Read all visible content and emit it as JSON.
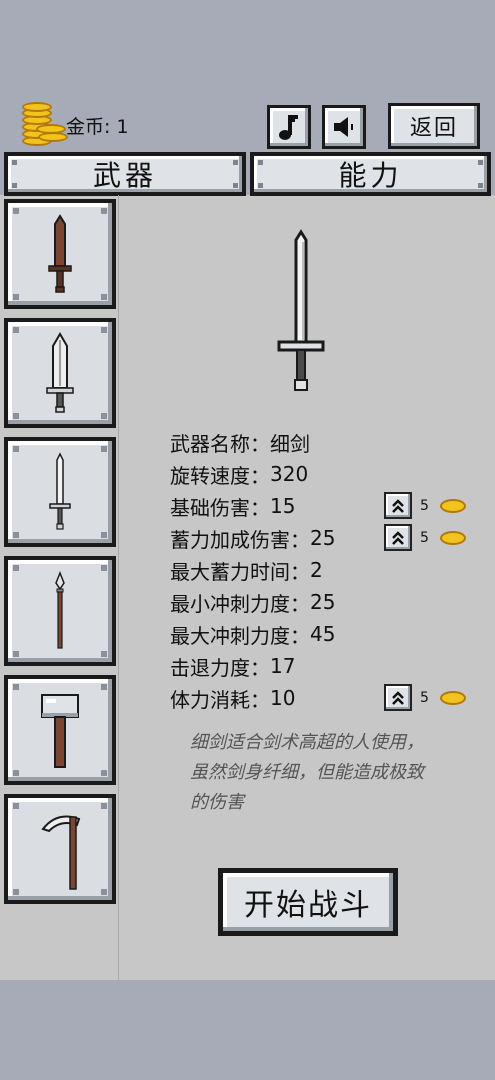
{
  "header": {
    "coins_label": "金币: 1",
    "music_icon": "music-note-icon",
    "sound_icon": "speaker-icon",
    "back_label": "返回"
  },
  "tabs": [
    {
      "label": "武器",
      "active": true
    },
    {
      "label": "能力",
      "active": false
    }
  ],
  "weapons": [
    {
      "icon": "wooden-sword-icon"
    },
    {
      "icon": "broad-sword-icon"
    },
    {
      "icon": "thin-sword-icon"
    },
    {
      "icon": "spear-icon"
    },
    {
      "icon": "hammer-icon"
    },
    {
      "icon": "scythe-icon"
    }
  ],
  "detail": {
    "stats": [
      {
        "label": "武器名称：",
        "value": "细剑"
      },
      {
        "label": "旋转速度：",
        "value": "320"
      },
      {
        "label": "基础伤害：",
        "value": "15",
        "upgrade_cost": "5"
      },
      {
        "label": "蓄力加成伤害：",
        "value": "25",
        "upgrade_cost": "5"
      },
      {
        "label": "最大蓄力时间：",
        "value": "2"
      },
      {
        "label": "最小冲刺力度：",
        "value": "25"
      },
      {
        "label": "最大冲刺力度：",
        "value": "45"
      },
      {
        "label": "击退力度：",
        "value": "17"
      },
      {
        "label": "体力消耗：",
        "value": "10",
        "upgrade_cost": "5"
      }
    ],
    "description": "细剑适合剑术高超的人使用，虽然剑身纤细，但能造成极致的伤害"
  },
  "start_button": "开始战斗",
  "colors": {
    "background": "#a7aab7",
    "panel": "#c7c7c7",
    "button_face": "#dfe2e6",
    "outline": "#1a1a1a",
    "coin_gold": "#f2c21e",
    "description_text": "#555555"
  }
}
